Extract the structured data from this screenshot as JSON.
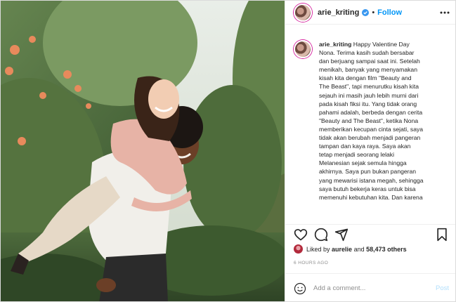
{
  "post": {
    "username": "arie_kriting",
    "verified_icon": "verified-badge-icon",
    "separator": "•",
    "follow_label": "Follow",
    "more_icon": "more-options-icon"
  },
  "caption": {
    "username": "arie_kriting",
    "lines": [
      "Happy Valentine Day",
      "Nona. Terima kasih sudah bersabar",
      "dan berjuang sampai saat ini. Setelah",
      "menikah, banyak yang menyamakan",
      "kisah kita dengan film \"Beauty and",
      "The Beast\", tapi menurutku kisah kita",
      "sejauh ini masih jauh lebih murni dari",
      "pada kisah fiksi itu. Yang tidak orang",
      "pahami adalah, berbeda dengan cerita",
      "\"Beauty and The Beast\", ketika Nona",
      "memberikan kecupan cinta sejati, saya",
      "tidak akan berubah menjadi pangeran",
      "tampan dan kaya raya. Saya akan",
      "tetap menjadi seorang lelaki",
      "Melanesian sejak semula hingga",
      "akhirnya. Saya pun bukan pangeran",
      "yang mewarisi istana megah, sehingga",
      "saya butuh bekerja keras untuk bisa",
      "memenuhi kebutuhan kita. Dan karena"
    ]
  },
  "actions": {
    "like_icon": "heart-icon",
    "comment_icon": "comment-icon",
    "share_icon": "share-icon",
    "save_icon": "bookmark-icon"
  },
  "likes": {
    "prefix": "Liked by",
    "user": "aurelie",
    "conjunction": "and",
    "others": "58,473 others"
  },
  "timestamp": "6 HOURS AGO",
  "comment": {
    "placeholder": "Add a comment...",
    "post_label": "Post",
    "emoji_icon": "emoji-icon"
  },
  "colors": {
    "accent": "#0095f6",
    "post_disabled": "#b2dffc",
    "muted": "#8e8e8e"
  }
}
